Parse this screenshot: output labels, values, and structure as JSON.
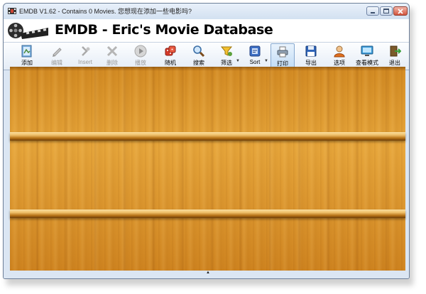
{
  "window": {
    "title": "EMDB V1.62 - Contains 0 Movies. 您想现在添加一些电影吗?"
  },
  "banner": {
    "title": "EMDB - Eric's Movie Database"
  },
  "toolbar": {
    "items": [
      {
        "label": "添加",
        "icon": "add-movie-icon",
        "enabled": true
      },
      {
        "label": "编辑",
        "icon": "edit-pencil-icon",
        "enabled": false
      },
      {
        "label": "Insert",
        "icon": "insert-icon",
        "enabled": false
      },
      {
        "label": "删除",
        "icon": "delete-icon",
        "enabled": false
      },
      {
        "label": "播放",
        "icon": "play-icon",
        "enabled": false
      },
      {
        "label": "随机",
        "icon": "dice-icon",
        "enabled": true
      },
      {
        "label": "搜索",
        "icon": "magnifier-icon",
        "enabled": true
      },
      {
        "label": "筛选",
        "icon": "filter-icon",
        "enabled": true,
        "dropdown": true
      },
      {
        "label": "Sort",
        "icon": "sort-icon",
        "enabled": true,
        "dropdown": true
      },
      {
        "label": "打印",
        "icon": "printer-icon",
        "enabled": true,
        "active": true
      },
      {
        "label": "导出",
        "icon": "floppy-disk-icon",
        "enabled": true
      },
      {
        "label": "选项",
        "icon": "user-options-icon",
        "enabled": true
      },
      {
        "label": "查看模式",
        "icon": "monitor-icon",
        "enabled": true
      },
      {
        "label": "退出",
        "icon": "exit-icon",
        "enabled": true
      }
    ]
  },
  "colors": {
    "wood_light": "#e6a53a",
    "wood_dark": "#cf8420",
    "toolbar_active": "#c2dcf5"
  }
}
